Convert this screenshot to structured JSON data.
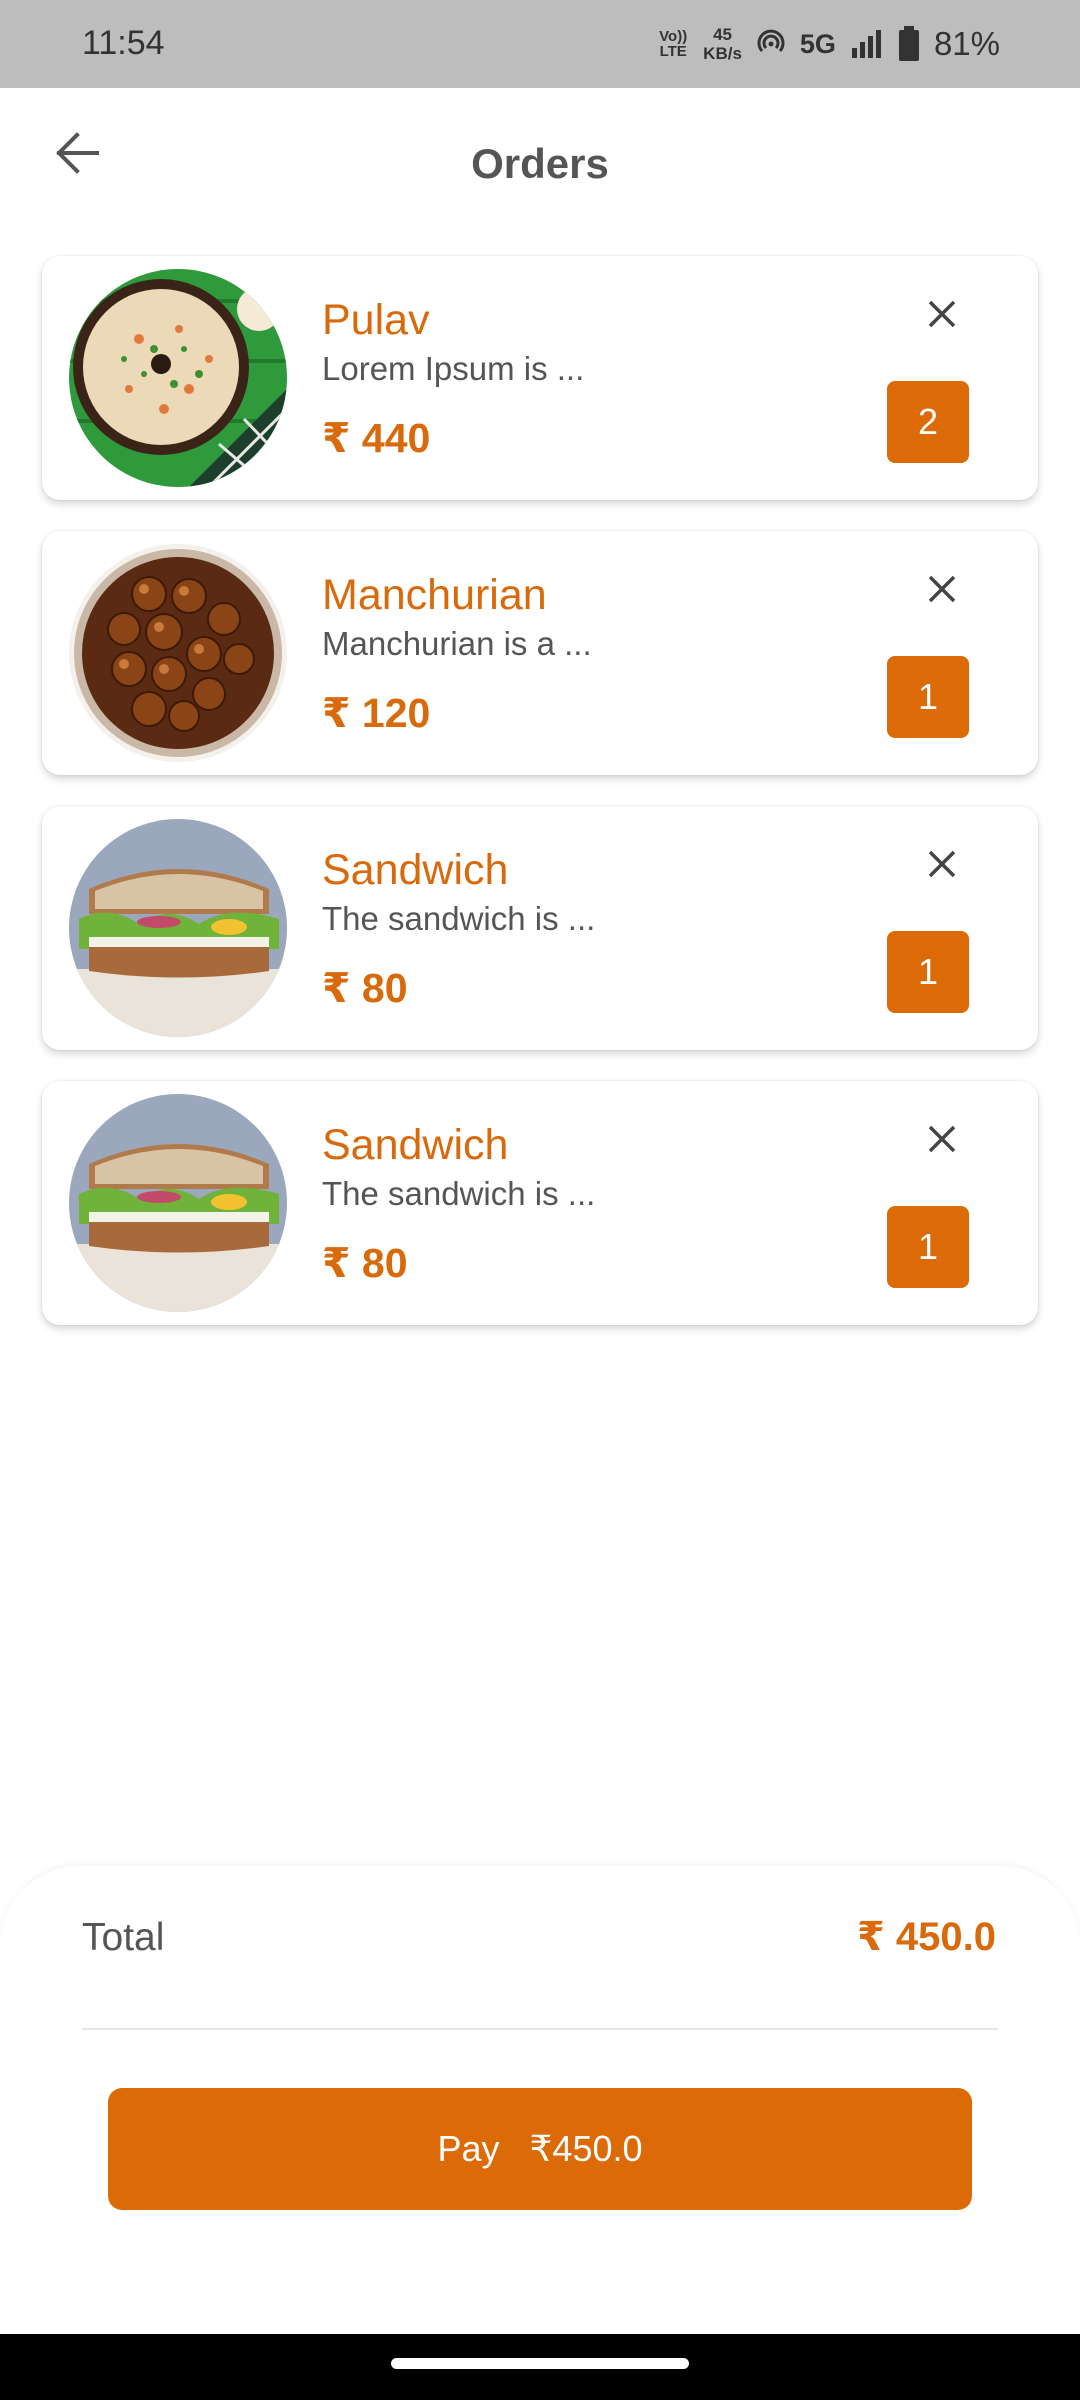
{
  "status_bar": {
    "time": "11:54",
    "volte_top": "Vo))",
    "volte_bottom": "LTE",
    "speed_value": "45",
    "speed_unit": "KB/s",
    "network": "5G",
    "battery": "81%"
  },
  "header": {
    "title": "Orders",
    "back_icon": "arrow-left-icon"
  },
  "orders": [
    {
      "name": "Pulav",
      "description": "Lorem Ipsum is ...",
      "price": "₹ 440",
      "quantity": "2",
      "image": "pulav-bowl"
    },
    {
      "name": "Manchurian",
      "description": "Manchurian is a ...",
      "price": "₹ 120",
      "quantity": "1",
      "image": "manchurian-bowl"
    },
    {
      "name": "Sandwich",
      "description": "The sandwich is ...",
      "price": "₹ 80",
      "quantity": "1",
      "image": "sandwich"
    },
    {
      "name": "Sandwich",
      "description": "The sandwich is ...",
      "price": "₹ 80",
      "quantity": "1",
      "image": "sandwich"
    }
  ],
  "summary": {
    "total_label": "Total",
    "total_value": "₹ 450.0",
    "pay_label": "Pay",
    "pay_amount": "₹450.0"
  },
  "colors": {
    "accent": "#dc6a07",
    "text": "#555555",
    "status_bar": "#bdbdbd"
  }
}
